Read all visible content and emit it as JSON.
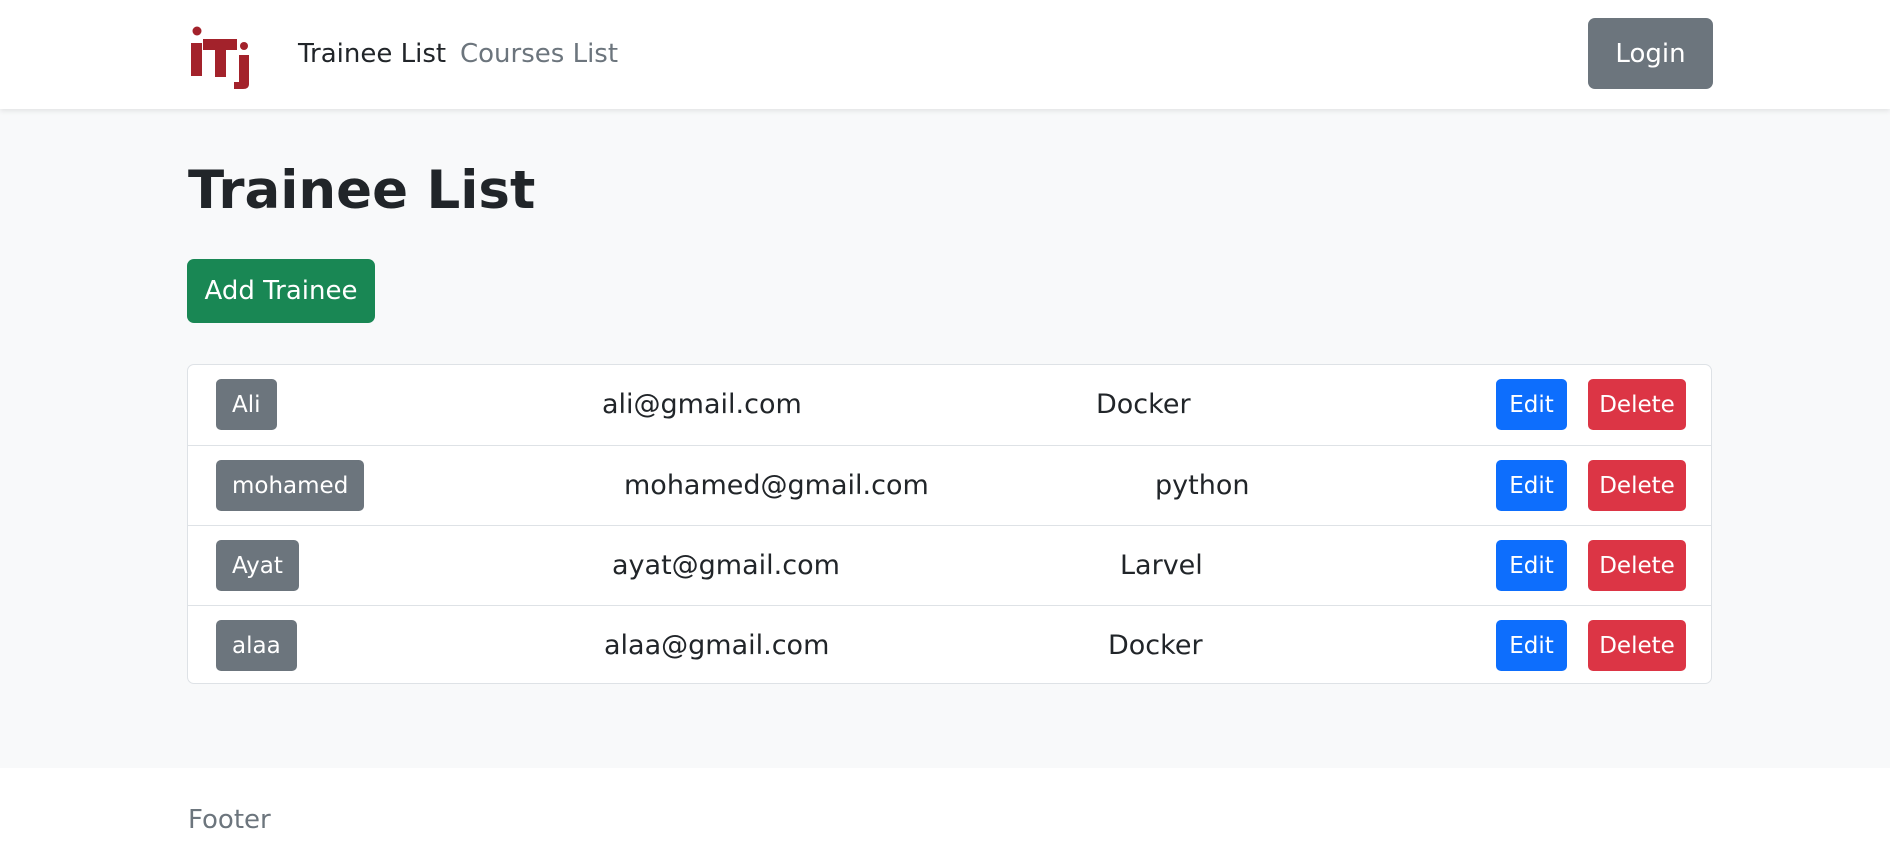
{
  "navbar": {
    "logo_icon": "iti-logo-icon",
    "links": [
      {
        "label": "Trainee List",
        "active": true
      },
      {
        "label": "Courses List",
        "active": false
      }
    ],
    "login_label": "Login"
  },
  "main": {
    "title": "Trainee List",
    "add_label": "Add Trainee",
    "trainees": [
      {
        "name": "Ali",
        "email": "ali@gmail.com",
        "course": "Docker",
        "edit_label": "Edit",
        "delete_label": "Delete"
      },
      {
        "name": "mohamed",
        "email": "mohamed@gmail.com",
        "course": "python",
        "edit_label": "Edit",
        "delete_label": "Delete"
      },
      {
        "name": "Ayat",
        "email": "ayat@gmail.com",
        "course": "Larvel",
        "edit_label": "Edit",
        "delete_label": "Delete"
      },
      {
        "name": "alaa",
        "email": "alaa@gmail.com",
        "course": "Docker",
        "edit_label": "Edit",
        "delete_label": "Delete"
      }
    ]
  },
  "footer": {
    "text": "Footer"
  },
  "colors": {
    "brand_red": "#a3222b",
    "primary": "#0d6efd",
    "success": "#198754",
    "danger": "#dc3545",
    "secondary": "#6c757d"
  }
}
